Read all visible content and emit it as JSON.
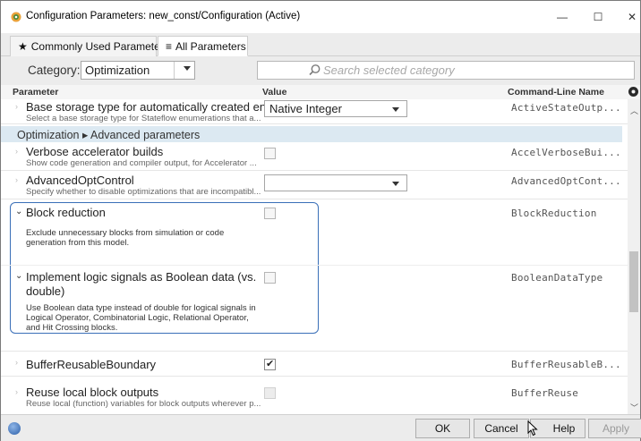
{
  "window": {
    "title": "Configuration Parameters: new_const/Configuration (Active)",
    "minimize": "—",
    "maximize": "☐",
    "close": "✕"
  },
  "tabs": [
    {
      "label": "Commonly Used Parameters",
      "glyph": "★",
      "active": false
    },
    {
      "label": "All Parameters",
      "glyph": "≡",
      "active": true
    }
  ],
  "category": {
    "label": "Category:",
    "value": "Optimization",
    "search_placeholder": "Search selected category"
  },
  "columns": {
    "parameter": "Parameter",
    "value": "Value",
    "command_line": "Command-Line Name"
  },
  "rows": {
    "base_storage": {
      "name": "Base storage type for automatically created en...",
      "desc": "Select a base storage type for Stateflow enumerations that a...",
      "value": "Native Integer",
      "cmd": "ActiveStateOutp..."
    },
    "group": {
      "label": "Optimization ▸ Advanced parameters"
    },
    "verbose": {
      "name": "Verbose accelerator builds",
      "desc": "Show code generation and compiler output, for Accelerator ...",
      "cmd": "AccelVerboseBui..."
    },
    "advopt": {
      "name": "AdvancedOptControl",
      "desc": "Specify whether to disable optimizations that are incompatibl...",
      "value": "",
      "cmd": "AdvancedOptCont..."
    },
    "block_reduction": {
      "name": "Block reduction",
      "desc_lines": [
        "Exclude unnecessary blocks from simulation or code",
        "generation from this model."
      ],
      "cmd": "BlockReduction"
    },
    "boolean_data": {
      "name_lines": [
        "Implement logic signals as Boolean data (vs.",
        "double)"
      ],
      "desc_lines": [
        "Use Boolean data type instead of double for logical signals in",
        "Logical Operator, Combinatorial Logic, Relational Operator,",
        "and Hit Crossing blocks."
      ],
      "cmd": "BooleanDataType"
    },
    "buffer_boundary": {
      "name": "BufferReusableBoundary",
      "checked": true,
      "cmd": "BufferReusableB..."
    },
    "reuse_outputs": {
      "name": "Reuse local block outputs",
      "desc": "Reuse local (function) variables for block outputs wherever p...",
      "cmd": "BufferReuse"
    }
  },
  "footer": {
    "ok": "OK",
    "cancel": "Cancel",
    "help": "Help",
    "apply": "Apply"
  },
  "colors": {
    "group_bg": "#dce9f2",
    "highlight": "#3a6fb8"
  }
}
